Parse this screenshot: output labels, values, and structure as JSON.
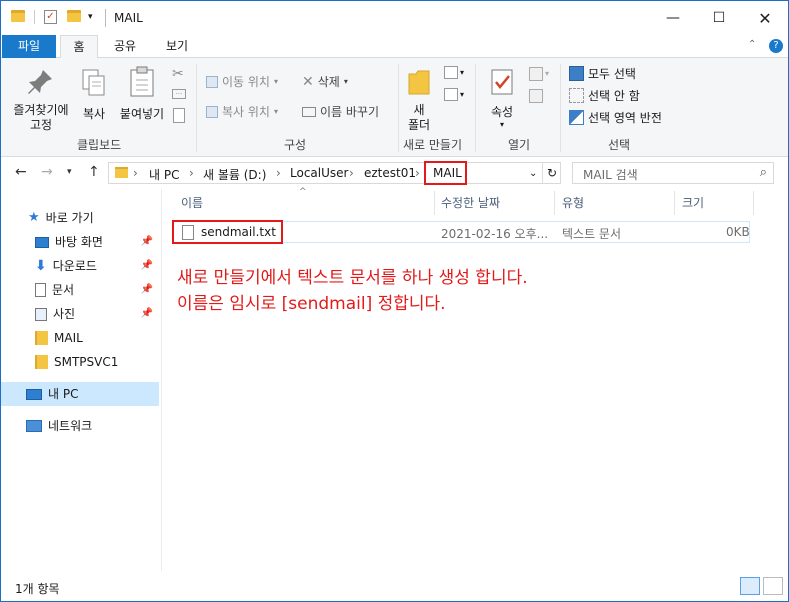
{
  "window": {
    "title": "MAIL"
  },
  "tabs": {
    "file": "파일",
    "home": "홈",
    "share": "공유",
    "view": "보기"
  },
  "ribbon": {
    "pin": "즐겨찾기에\n고정",
    "copy": "복사",
    "paste": "붙여넣기",
    "clipboard_group": "클립보드",
    "move_to": "이동 위치",
    "copy_to": "복사 위치",
    "delete": "삭제",
    "rename": "이름 바꾸기",
    "organize_group": "구성",
    "new_folder": "새\n폴더",
    "new_group": "새로 만들기",
    "properties": "속성",
    "open_group": "열기",
    "select_all": "모두 선택",
    "select_none": "선택 안 함",
    "invert_selection": "선택 영역 반전",
    "select_group": "선택"
  },
  "address": {
    "crumbs": [
      "내 PC",
      "새 볼륨 (D:)",
      "LocalUser",
      "eztest01",
      "MAIL"
    ],
    "search_placeholder": "MAIL 검색"
  },
  "navpane": {
    "quick_access": "바로 가기",
    "items": [
      "바탕 화면",
      "다운로드",
      "문서",
      "사진",
      "MAIL",
      "SMTPSVC1"
    ],
    "this_pc": "내 PC",
    "network": "네트워크"
  },
  "columns": {
    "name": "이름",
    "modified": "수정한 날짜",
    "type": "유형",
    "size": "크기"
  },
  "files": [
    {
      "name": "sendmail.txt",
      "modified": "2021-02-16 오후...",
      "type": "텍스트 문서",
      "size": "0KB"
    }
  ],
  "annotation": {
    "line1": "새로 만들기에서 텍스트 문서를 하나 생성 합니다.",
    "line2": "이름은 임시로 [sendmail] 정합니다."
  },
  "status": {
    "count": "1개 항목"
  },
  "colors": {
    "accent": "#1979ca",
    "highlight": "#e21a1a",
    "folder": "#f4c542"
  }
}
